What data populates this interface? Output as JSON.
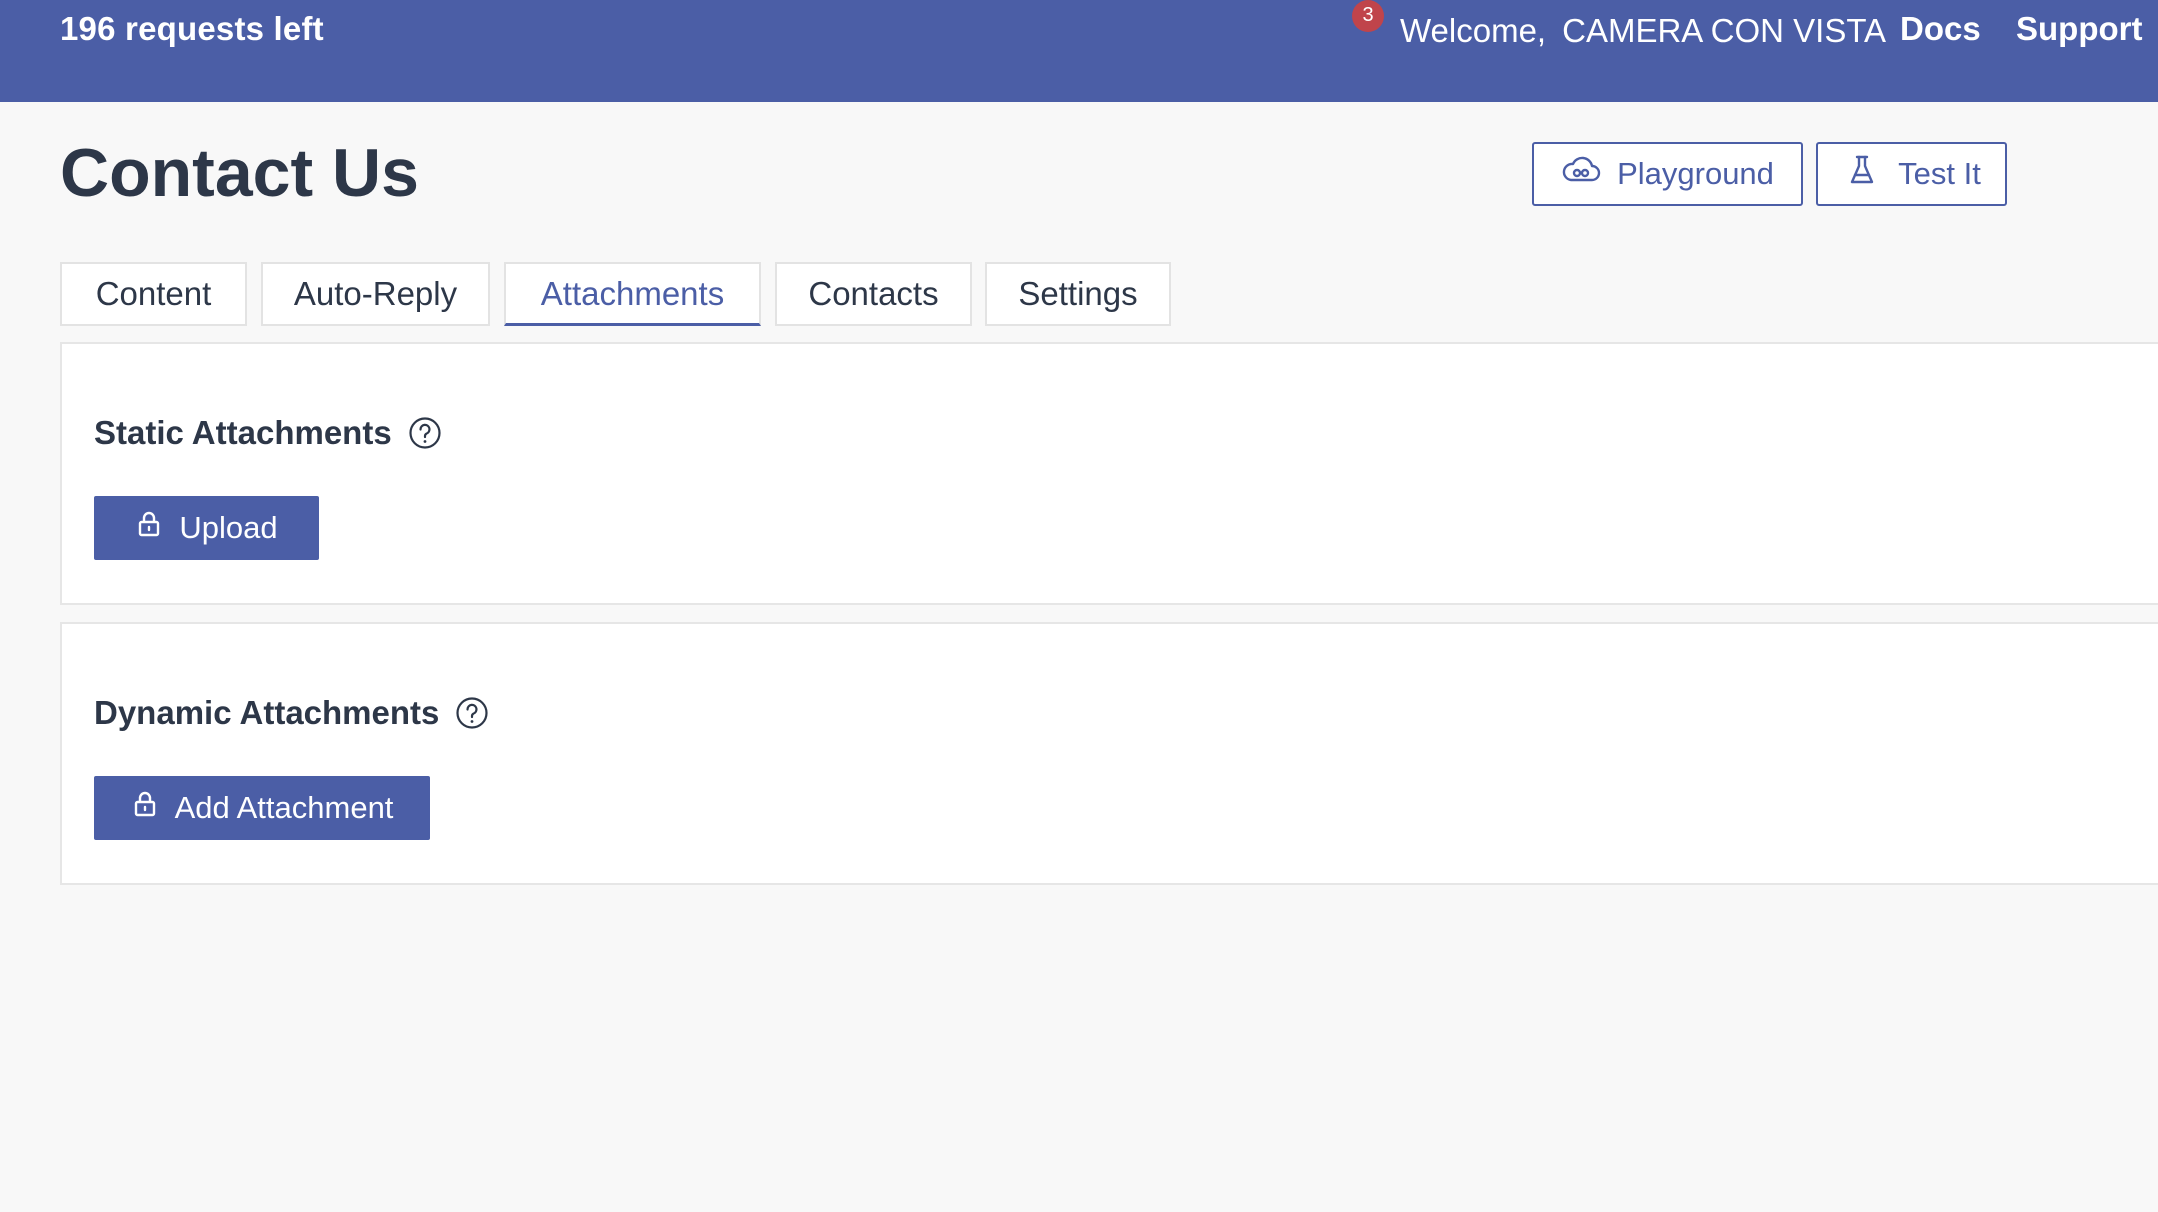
{
  "header": {
    "requests_left": "196 requests left",
    "notification_count": "3",
    "welcome_label": "Welcome,",
    "user_name": "CAMERA CON VISTA",
    "docs_label": "Docs",
    "support_label": "Support",
    "background_color": "#4b5ea6"
  },
  "page": {
    "title": "Contact Us",
    "playground_label": "Playground",
    "test_it_label": "Test It"
  },
  "tabs": [
    {
      "label": "Content",
      "active": false
    },
    {
      "label": "Auto-Reply",
      "active": false
    },
    {
      "label": "Attachments",
      "active": true
    },
    {
      "label": "Contacts",
      "active": false
    },
    {
      "label": "Settings",
      "active": false
    }
  ],
  "static_attachments": {
    "heading": "Static Attachments",
    "upload_label": "Upload"
  },
  "dynamic_attachments": {
    "heading": "Dynamic Attachments",
    "add_label": "Add Attachment"
  },
  "icons": {
    "playground": "cloud-icon",
    "test_it": "flask-icon",
    "help": "question-circle-icon",
    "upload": "lock-icon",
    "add_attachment": "lock-icon"
  },
  "colors": {
    "accent": "#4b5ea6",
    "badge": "#c0444b",
    "text": "#2d3748"
  }
}
